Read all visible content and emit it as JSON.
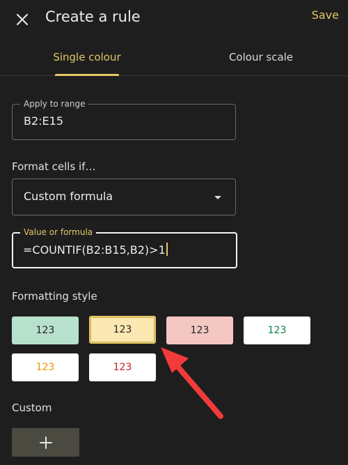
{
  "header": {
    "close_icon": "close-icon",
    "title": "Create a rule",
    "save_label": "Save"
  },
  "tabs": [
    {
      "label": "Single colour",
      "active": true
    },
    {
      "label": "Colour scale",
      "active": false
    }
  ],
  "apply_range": {
    "label": "Apply to range",
    "value": "B2:E15"
  },
  "format_cells": {
    "label": "Format cells if…",
    "selected": "Custom formula",
    "caret_icon": "caret-down-icon"
  },
  "formula": {
    "label": "Value or formula",
    "value": "=COUNTIF(B2:B15,B2)>1"
  },
  "formatting_style": {
    "label": "Formatting style",
    "swatches": [
      {
        "text": "123",
        "bg": "#b7e1cd",
        "fg": "#1f1f1f",
        "selected": false
      },
      {
        "text": "123",
        "bg": "#fce8b2",
        "fg": "#1f1f1f",
        "selected": true
      },
      {
        "text": "123",
        "bg": "#f4c7c3",
        "fg": "#1f1f1f",
        "selected": false
      },
      {
        "text": "123",
        "bg": "#ffffff",
        "fg": "#0b8043",
        "selected": false
      },
      {
        "text": "123",
        "bg": "#ffffff",
        "fg": "#f09300",
        "selected": false
      },
      {
        "text": "123",
        "bg": "#ffffff",
        "fg": "#c5221f",
        "selected": false
      }
    ]
  },
  "custom": {
    "label": "Custom",
    "add_icon": "plus-icon"
  },
  "colors": {
    "accent": "#e2c766",
    "background": "#1e1e1e",
    "annotation_arrow": "#f23a3a"
  }
}
